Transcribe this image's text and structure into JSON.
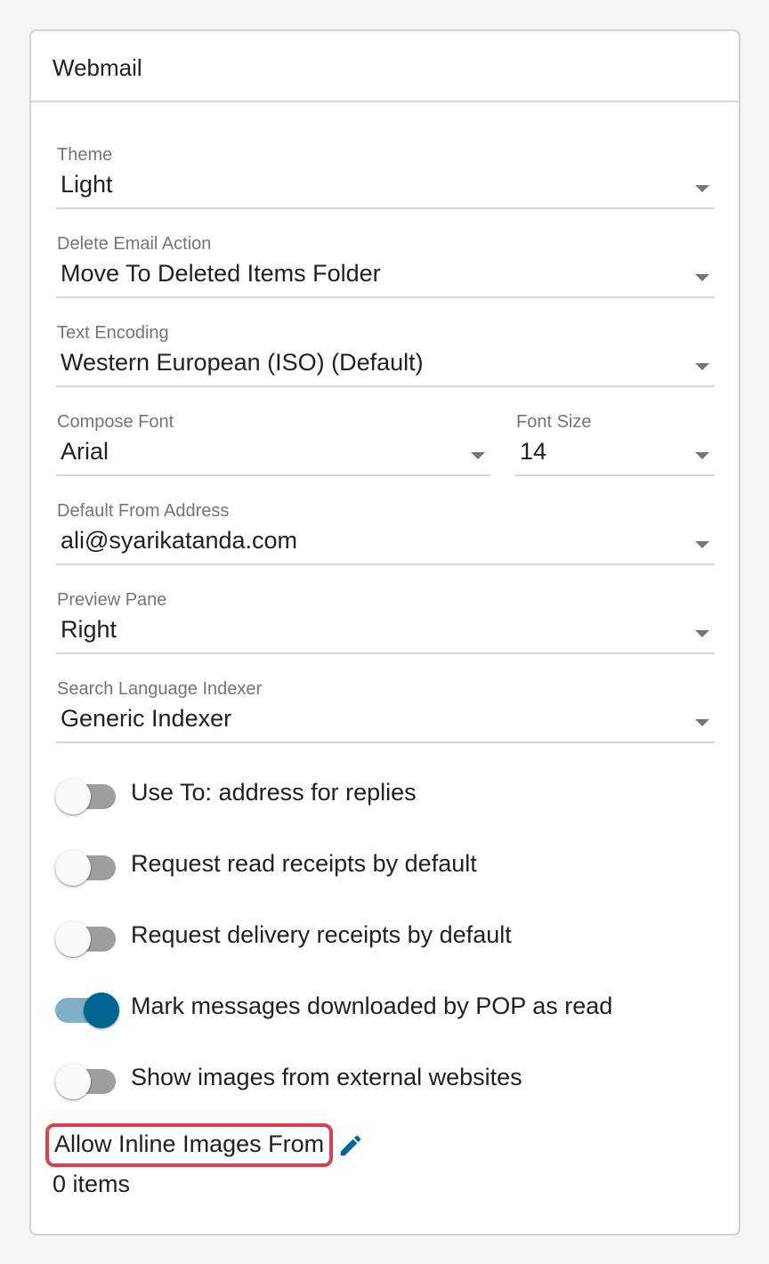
{
  "card": {
    "title": "Webmail"
  },
  "fields": {
    "theme": {
      "label": "Theme",
      "value": "Light"
    },
    "delete_action": {
      "label": "Delete Email Action",
      "value": "Move To Deleted Items Folder"
    },
    "text_encoding": {
      "label": "Text Encoding",
      "value": "Western European (ISO) (Default)"
    },
    "compose_font": {
      "label": "Compose Font",
      "value": "Arial"
    },
    "font_size": {
      "label": "Font Size",
      "value": "14"
    },
    "from_address": {
      "label": "Default From Address",
      "value": "ali@syarikatanda.com"
    },
    "preview_pane": {
      "label": "Preview Pane",
      "value": "Right"
    },
    "search_indexer": {
      "label": "Search Language Indexer",
      "value": "Generic Indexer"
    }
  },
  "toggles": [
    {
      "label": "Use To: address for replies",
      "on": false
    },
    {
      "label": "Request read receipts by default",
      "on": false
    },
    {
      "label": "Request delivery receipts by default",
      "on": false
    },
    {
      "label": "Mark messages downloaded by POP as read",
      "on": true
    },
    {
      "label": "Show images from external websites",
      "on": false
    }
  ],
  "inline_images": {
    "label": "Allow Inline Images From",
    "count_text": "0 items"
  },
  "colors": {
    "accent": "#006592",
    "accent_track": "#7eb1c8",
    "highlight_border": "#d9424d",
    "off_track": "#9e9e9e"
  },
  "icons": {
    "edit": "pencil-icon",
    "dropdown": "caret-down-icon"
  }
}
